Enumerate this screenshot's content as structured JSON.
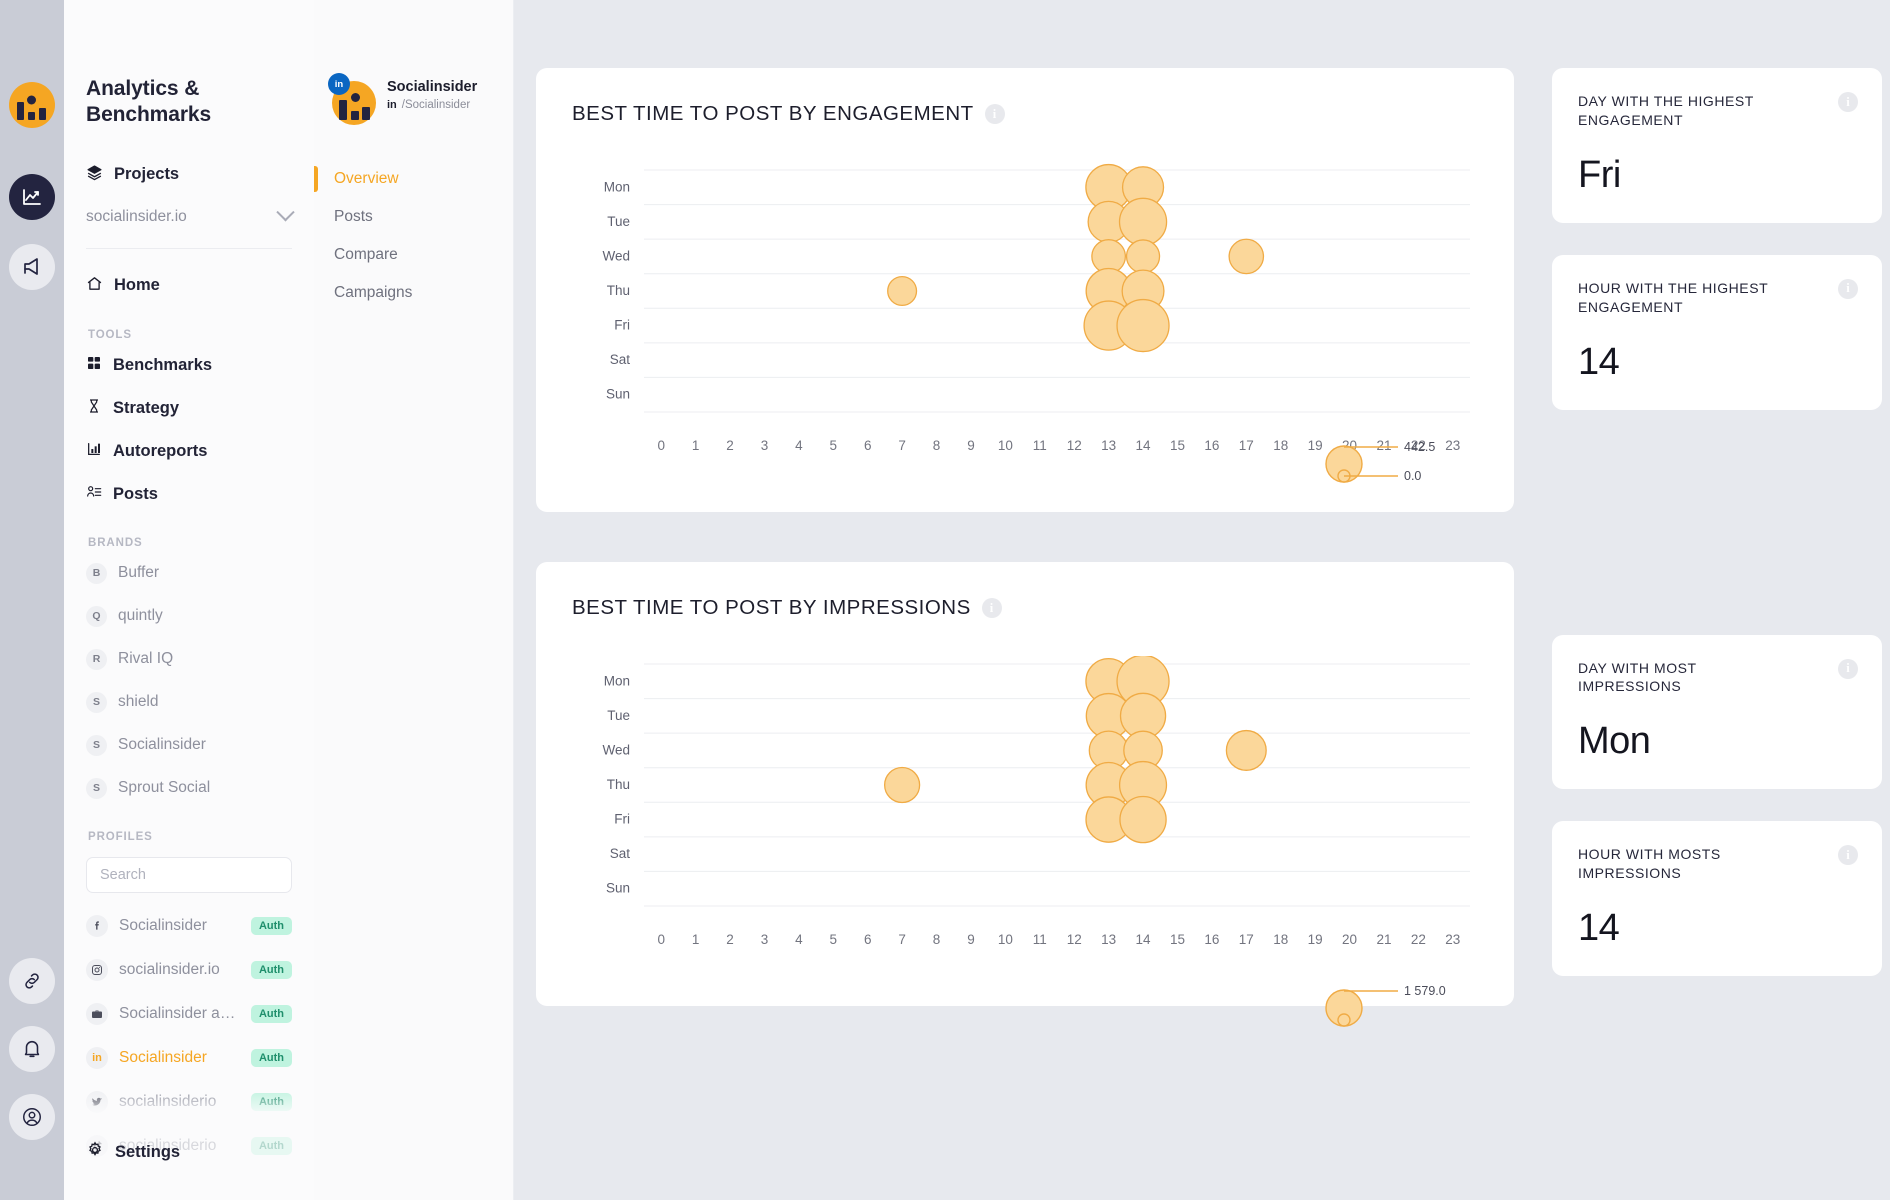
{
  "rail": {
    "icons": [
      {
        "name": "brand-logo-icon"
      },
      {
        "name": "analytics-icon"
      },
      {
        "name": "megaphone-icon"
      }
    ],
    "bottom_icons": [
      {
        "name": "link-icon"
      },
      {
        "name": "bell-icon"
      },
      {
        "name": "account-icon"
      }
    ]
  },
  "sidebar": {
    "title": "Analytics & Benchmarks",
    "projects_label": "Projects",
    "project_selected": "socialinsider.io",
    "home_label": "Home",
    "tools_section": "TOOLS",
    "tools": [
      {
        "label": "Benchmarks",
        "icon": "grid-icon"
      },
      {
        "label": "Strategy",
        "icon": "chess-rook-icon"
      },
      {
        "label": "Autoreports",
        "icon": "bar-chart-icon"
      },
      {
        "label": "Posts",
        "icon": "posts-list-icon"
      }
    ],
    "brands_section": "BRANDS",
    "brands": [
      {
        "letter": "B",
        "label": "Buffer"
      },
      {
        "letter": "Q",
        "label": "quintly"
      },
      {
        "letter": "R",
        "label": "Rival IQ"
      },
      {
        "letter": "S",
        "label": "shield"
      },
      {
        "letter": "S",
        "label": "Socialinsider"
      },
      {
        "letter": "S",
        "label": "Sprout Social"
      }
    ],
    "profiles_section": "PROFILES",
    "search_placeholder": "Search",
    "search_value": "",
    "profiles": [
      {
        "label": "Socialinsider",
        "network": "facebook",
        "badge": "Auth",
        "active": false
      },
      {
        "label": "socialinsider.io",
        "network": "instagram",
        "badge": "Auth",
        "active": false
      },
      {
        "label": "Socialinsider ads ac...",
        "network": "briefcase",
        "badge": "Auth",
        "active": false
      },
      {
        "label": "Socialinsider",
        "network": "linkedin",
        "badge": "Auth",
        "active": true
      },
      {
        "label": "socialinsiderio",
        "network": "twitter",
        "badge": "Auth",
        "active": false
      },
      {
        "label": "socialinsiderio",
        "network": "tiktok",
        "badge": "Auth",
        "active": false
      }
    ],
    "settings_label": "Settings"
  },
  "panel2": {
    "profile_name": "Socialinsider",
    "network_tag": "in",
    "handle": "/Socialinsider",
    "nav": [
      {
        "label": "Overview",
        "active": true
      },
      {
        "label": "Posts",
        "active": false
      },
      {
        "label": "Compare",
        "active": false
      },
      {
        "label": "Campaigns",
        "active": false
      }
    ]
  },
  "kpis": [
    {
      "label": "DAY WITH THE HIGHEST ENGAGEMENT",
      "value": "Fri"
    },
    {
      "label": "HOUR WITH THE HIGHEST ENGAGEMENT",
      "value": "14"
    },
    {
      "label": "DAY WITH MOST IMPRESSIONS",
      "value": "Mon"
    },
    {
      "label": "HOUR WITH MOSTS IMPRESSIONS",
      "value": "14"
    }
  ],
  "colors": {
    "accent": "#f5a623",
    "bubble_fill": "#fbd79a",
    "bubble_stroke": "#f0ab45",
    "page_bg": "#e7e9ee",
    "card_bg": "#ffffff",
    "auth_bg": "#bff3df",
    "auth_text": "#1f8f6c"
  },
  "chart_data": [
    {
      "type": "scatter",
      "title": "BEST TIME TO POST BY ENGAGEMENT",
      "xlabel": "",
      "ylabel": "",
      "x_ticks": [
        "0",
        "1",
        "2",
        "3",
        "4",
        "5",
        "6",
        "7",
        "8",
        "9",
        "10",
        "11",
        "12",
        "13",
        "14",
        "15",
        "16",
        "17",
        "18",
        "19",
        "20",
        "21",
        "22",
        "23"
      ],
      "y_categories": [
        "Mon",
        "Tue",
        "Wed",
        "Thu",
        "Fri",
        "Sat",
        "Sun"
      ],
      "grid": true,
      "legend": {
        "position": "bottom-right",
        "max_label": "442.5",
        "min_label": "0.0"
      },
      "size_scale": [
        0.0,
        442.5
      ],
      "points": [
        {
          "day": "Mon",
          "hour": 13,
          "size": 310
        },
        {
          "day": "Mon",
          "hour": 14,
          "size": 232
        },
        {
          "day": "Tue",
          "hour": 13,
          "size": 232
        },
        {
          "day": "Tue",
          "hour": 14,
          "size": 340
        },
        {
          "day": "Wed",
          "hour": 13,
          "size": 128
        },
        {
          "day": "Wed",
          "hour": 14,
          "size": 122
        },
        {
          "day": "Wed",
          "hour": 17,
          "size": 138
        },
        {
          "day": "Thu",
          "hour": 7,
          "size": 78
        },
        {
          "day": "Thu",
          "hour": 13,
          "size": 300
        },
        {
          "day": "Thu",
          "hour": 14,
          "size": 245
        },
        {
          "day": "Fri",
          "hour": 13,
          "size": 380
        },
        {
          "day": "Fri",
          "hour": 14,
          "size": 442.5
        }
      ]
    },
    {
      "type": "scatter",
      "title": "BEST TIME TO POST BY IMPRESSIONS",
      "xlabel": "",
      "ylabel": "",
      "x_ticks": [
        "0",
        "1",
        "2",
        "3",
        "4",
        "5",
        "6",
        "7",
        "8",
        "9",
        "10",
        "11",
        "12",
        "13",
        "14",
        "15",
        "16",
        "17",
        "18",
        "19",
        "20",
        "21",
        "22",
        "23"
      ],
      "y_categories": [
        "Mon",
        "Tue",
        "Wed",
        "Thu",
        "Fri",
        "Sat",
        "Sun"
      ],
      "grid": true,
      "legend": {
        "position": "bottom-right",
        "max_label": "1 579.0",
        "min_label": ""
      },
      "size_scale": [
        0.0,
        1579.0
      ],
      "points": [
        {
          "day": "Mon",
          "hour": 13,
          "size": 1100
        },
        {
          "day": "Mon",
          "hour": 14,
          "size": 1579
        },
        {
          "day": "Tue",
          "hour": 13,
          "size": 1050
        },
        {
          "day": "Tue",
          "hour": 14,
          "size": 1080
        },
        {
          "day": "Wed",
          "hour": 13,
          "size": 700
        },
        {
          "day": "Wed",
          "hour": 14,
          "size": 690
        },
        {
          "day": "Wed",
          "hour": 17,
          "size": 760
        },
        {
          "day": "Thu",
          "hour": 7,
          "size": 520
        },
        {
          "day": "Thu",
          "hour": 13,
          "size": 1070
        },
        {
          "day": "Thu",
          "hour": 14,
          "size": 1200
        },
        {
          "day": "Fri",
          "hour": 13,
          "size": 1090
        },
        {
          "day": "Fri",
          "hour": 14,
          "size": 1150
        }
      ]
    }
  ]
}
